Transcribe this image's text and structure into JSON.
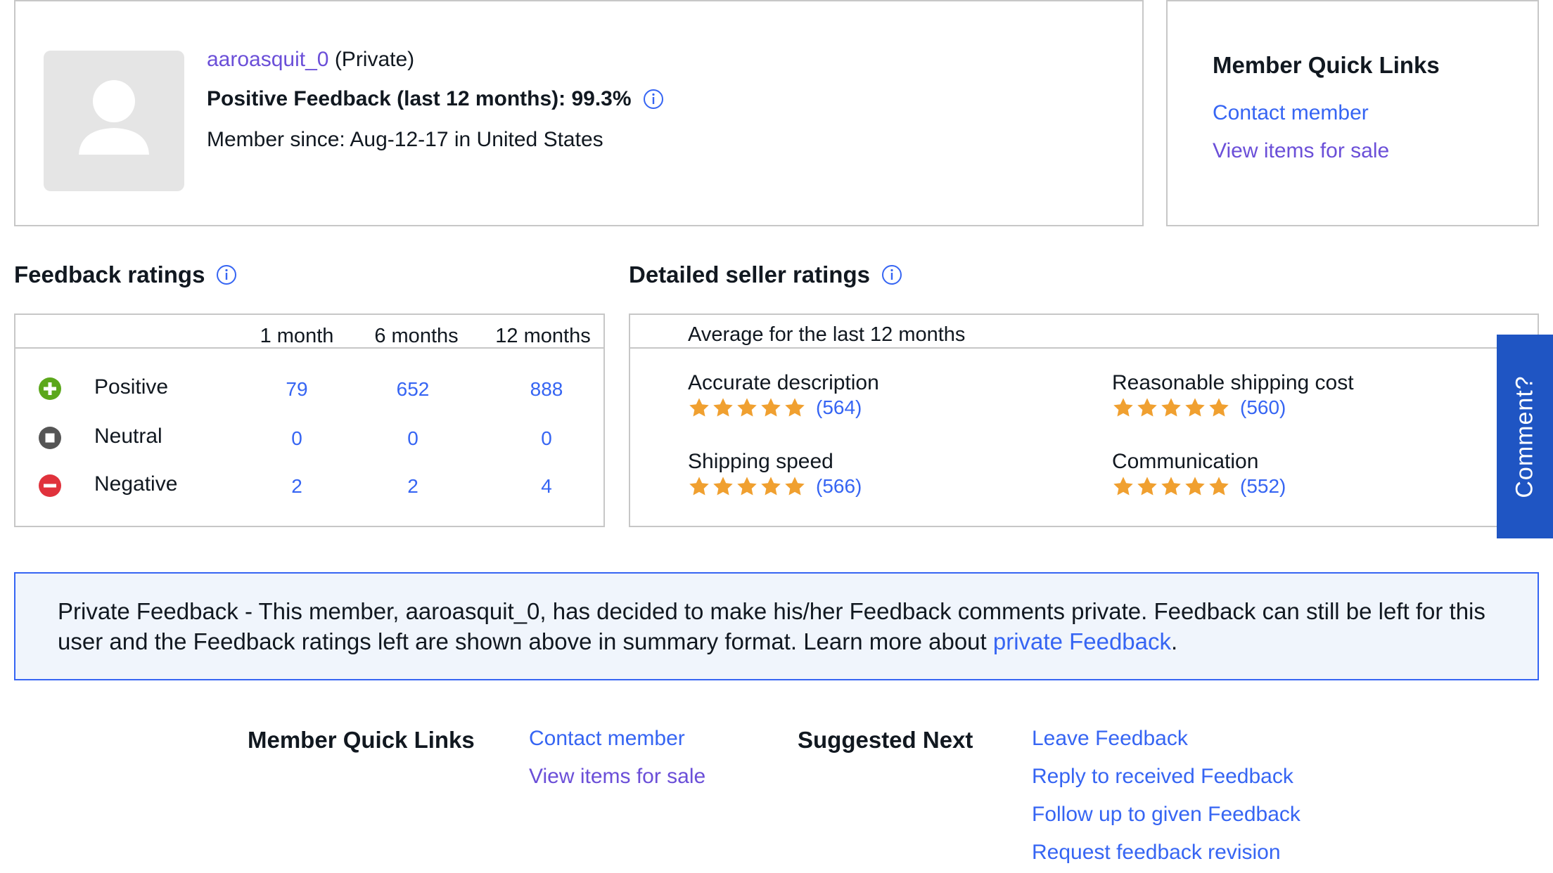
{
  "profile": {
    "username": "aaroasquit_0",
    "privacy": "(Private)",
    "positive_feedback": "Positive Feedback (last 12 months): 99.3%",
    "member_since": "Member since: Aug-12-17 in United States"
  },
  "quick_links_card": {
    "title": "Member Quick Links",
    "contact": "Contact member",
    "view_items": "View items for sale"
  },
  "feedback_ratings": {
    "title": "Feedback ratings",
    "columns": [
      "1 month",
      "6 months",
      "12 months"
    ],
    "rows": [
      {
        "label": "Positive",
        "values": [
          "79",
          "652",
          "888"
        ]
      },
      {
        "label": "Neutral",
        "values": [
          "0",
          "0",
          "0"
        ]
      },
      {
        "label": "Negative",
        "values": [
          "2",
          "2",
          "4"
        ]
      }
    ]
  },
  "seller_ratings": {
    "title": "Detailed seller ratings",
    "subtitle": "Average for the last 12 months",
    "items": [
      {
        "name": "Accurate description",
        "count": "(564)",
        "stars": 5
      },
      {
        "name": "Reasonable shipping cost",
        "count": "(560)",
        "stars": 5
      },
      {
        "name": "Shipping speed",
        "count": "(566)",
        "stars": 5
      },
      {
        "name": "Communication",
        "count": "(552)",
        "stars": 5
      }
    ]
  },
  "comment_tab": "Comment?",
  "notice": {
    "text": "Private Feedback - This member, aaroasquit_0, has decided to make his/her Feedback comments private. Feedback can still be left for this user and the Feedback ratings left are shown above in summary format. Learn more about ",
    "link": "private Feedback",
    "end": "."
  },
  "footer": {
    "quick_links_title": "Member Quick Links",
    "contact": "Contact member",
    "view_items": "View items for sale",
    "suggested_title": "Suggested Next",
    "suggested": [
      "Leave Feedback",
      "Reply to received Feedback",
      "Follow up to given Feedback",
      "Request feedback revision"
    ]
  },
  "colors": {
    "link": "#3665f3",
    "visited": "#6b4fd8",
    "star": "#f0a030",
    "positive": "#5ba71b",
    "neutral": "#555555",
    "negative": "#e0323c",
    "comment_tab": "#1f55c3",
    "notice_bg": "#f0f5fc",
    "notice_border": "#3665f3"
  }
}
